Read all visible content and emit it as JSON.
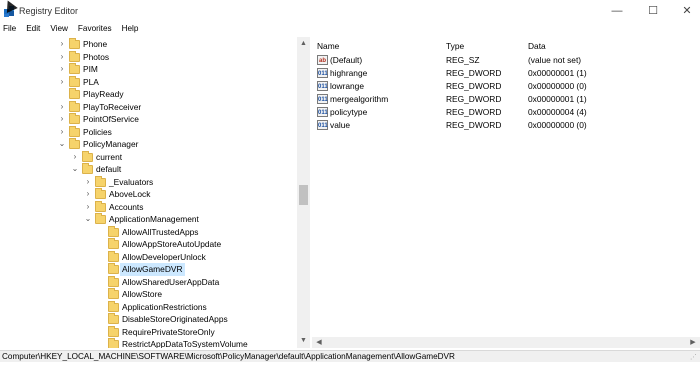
{
  "window": {
    "title": "Registry Editor",
    "min_glyph": "—",
    "max_glyph": "☐",
    "close_glyph": "✕"
  },
  "menu": [
    "File",
    "Edit",
    "View",
    "Favorites",
    "Help"
  ],
  "tree": [
    {
      "label": "Phone",
      "depth": 0,
      "expander": "collapsed"
    },
    {
      "label": "Photos",
      "depth": 0,
      "expander": "collapsed"
    },
    {
      "label": "PIM",
      "depth": 0,
      "expander": "collapsed"
    },
    {
      "label": "PLA",
      "depth": 0,
      "expander": "collapsed"
    },
    {
      "label": "PlayReady",
      "depth": 0,
      "expander": "none"
    },
    {
      "label": "PlayToReceiver",
      "depth": 0,
      "expander": "collapsed"
    },
    {
      "label": "PointOfService",
      "depth": 0,
      "expander": "collapsed"
    },
    {
      "label": "Policies",
      "depth": 0,
      "expander": "collapsed"
    },
    {
      "label": "PolicyManager",
      "depth": 0,
      "expander": "expanded"
    },
    {
      "label": "current",
      "depth": 1,
      "expander": "collapsed"
    },
    {
      "label": "default",
      "depth": 1,
      "expander": "expanded"
    },
    {
      "label": "_Evaluators",
      "depth": 2,
      "expander": "collapsed"
    },
    {
      "label": "AboveLock",
      "depth": 2,
      "expander": "collapsed"
    },
    {
      "label": "Accounts",
      "depth": 2,
      "expander": "collapsed"
    },
    {
      "label": "ApplicationManagement",
      "depth": 2,
      "expander": "expanded"
    },
    {
      "label": "AllowAllTrustedApps",
      "depth": 3,
      "expander": "none"
    },
    {
      "label": "AllowAppStoreAutoUpdate",
      "depth": 3,
      "expander": "none"
    },
    {
      "label": "AllowDeveloperUnlock",
      "depth": 3,
      "expander": "none"
    },
    {
      "label": "AllowGameDVR",
      "depth": 3,
      "expander": "none",
      "selected": true
    },
    {
      "label": "AllowSharedUserAppData",
      "depth": 3,
      "expander": "none"
    },
    {
      "label": "AllowStore",
      "depth": 3,
      "expander": "none"
    },
    {
      "label": "ApplicationRestrictions",
      "depth": 3,
      "expander": "none"
    },
    {
      "label": "DisableStoreOriginatedApps",
      "depth": 3,
      "expander": "none"
    },
    {
      "label": "RequirePrivateStoreOnly",
      "depth": 3,
      "expander": "none"
    },
    {
      "label": "RestrictAppDataToSystemVolume",
      "depth": 3,
      "expander": "none"
    }
  ],
  "values": {
    "columns": {
      "name": "Name",
      "type": "Type",
      "data": "Data"
    },
    "rows": [
      {
        "icon": "string-value-icon",
        "name": "(Default)",
        "type": "REG_SZ",
        "data": "(value not set)"
      },
      {
        "icon": "dword-value-icon",
        "name": "highrange",
        "type": "REG_DWORD",
        "data": "0x00000001 (1)"
      },
      {
        "icon": "dword-value-icon",
        "name": "lowrange",
        "type": "REG_DWORD",
        "data": "0x00000000 (0)"
      },
      {
        "icon": "dword-value-icon",
        "name": "mergealgorithm",
        "type": "REG_DWORD",
        "data": "0x00000001 (1)"
      },
      {
        "icon": "dword-value-icon",
        "name": "policytype",
        "type": "REG_DWORD",
        "data": "0x00000004 (4)"
      },
      {
        "icon": "dword-value-icon",
        "name": "value",
        "type": "REG_DWORD",
        "data": "0x00000000 (0)"
      }
    ]
  },
  "status": {
    "path": "Computer\\HKEY_LOCAL_MACHINE\\SOFTWARE\\Microsoft\\PolicyManager\\default\\ApplicationManagement\\AllowGameDVR"
  },
  "colors": {
    "selection": "#cce8ff",
    "folder": "#f6d36b"
  }
}
